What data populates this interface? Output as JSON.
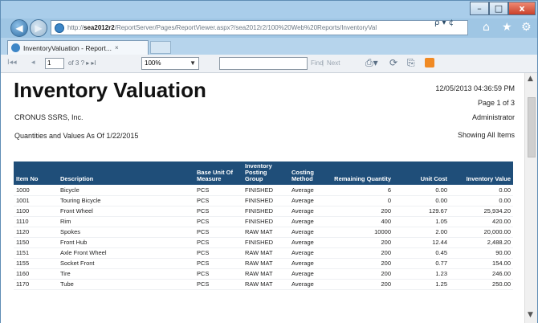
{
  "window": {
    "caption_buttons": {
      "minimize": "–",
      "maximize": "□",
      "close": "x"
    }
  },
  "browser": {
    "address_prefix": "http://",
    "address_host": "sea2012r2",
    "address_rest": "/ReportServer/Pages/ReportViewer.aspx?/sea2012r2/100%20Web%20Reports/InventoryVal",
    "address_tools": "ρ ▾ ¢",
    "tab_label": "InventoryValuation - Report...",
    "tab_close": "×"
  },
  "toolbar": {
    "first": "I◂◂",
    "prev": "◂",
    "page_value": "1",
    "page_of": "of 3 ? ▸ ▸I",
    "zoom": "100%",
    "find_label": "Find",
    "next_label": "Next"
  },
  "report": {
    "title": "Inventory Valuation",
    "company": "CRONUS SSRS, Inc.",
    "as_of": "Quantities and Values As Of 1/22/2015",
    "timestamp": "12/05/2013 04:36:59 PM",
    "page_info": "Page 1 of 3",
    "user": "Administrator",
    "filter": "Showing All Items"
  },
  "table": {
    "headers": [
      "Item No",
      "Description",
      "Base Unit Of Measure",
      "Inventory Posting Group",
      "Costing Method",
      "Remaining Quantity",
      "Unit Cost",
      "Inventory Value"
    ],
    "rows": [
      [
        "1000",
        "Bicycle",
        "PCS",
        "FINISHED",
        "Average",
        "6",
        "0.00",
        "0.00"
      ],
      [
        "1001",
        "Touring Bicycle",
        "PCS",
        "FINISHED",
        "Average",
        "0",
        "0.00",
        "0.00"
      ],
      [
        "1100",
        "Front Wheel",
        "PCS",
        "FINISHED",
        "Average",
        "200",
        "129.67",
        "25,934.20"
      ],
      [
        "1110",
        "Rim",
        "PCS",
        "FINISHED",
        "Average",
        "400",
        "1.05",
        "420.00"
      ],
      [
        "1120",
        "Spokes",
        "PCS",
        "RAW MAT",
        "Average",
        "10000",
        "2.00",
        "20,000.00"
      ],
      [
        "1150",
        "Front Hub",
        "PCS",
        "FINISHED",
        "Average",
        "200",
        "12.44",
        "2,488.20"
      ],
      [
        "1151",
        "Axle Front Wheel",
        "PCS",
        "RAW MAT",
        "Average",
        "200",
        "0.45",
        "90.00"
      ],
      [
        "1155",
        "Socket Front",
        "PCS",
        "RAW MAT",
        "Average",
        "200",
        "0.77",
        "154.00"
      ],
      [
        "1160",
        "Tire",
        "PCS",
        "RAW MAT",
        "Average",
        "200",
        "1.23",
        "246.00"
      ],
      [
        "1170",
        "Tube",
        "PCS",
        "RAW MAT",
        "Average",
        "200",
        "1.25",
        "250.00"
      ]
    ]
  },
  "icons": {
    "back": "back-arrow-icon",
    "forward": "forward-arrow-icon",
    "home": "home-icon",
    "favorites": "star-icon",
    "settings": "gear-icon",
    "export": "export-icon",
    "refresh": "refresh-icon",
    "print": "print-icon",
    "feed": "feed-icon"
  },
  "colors": {
    "header_bg": "#1f4e79",
    "chrome_bg": "#9fc6e4",
    "close_button": "#c9412b"
  }
}
